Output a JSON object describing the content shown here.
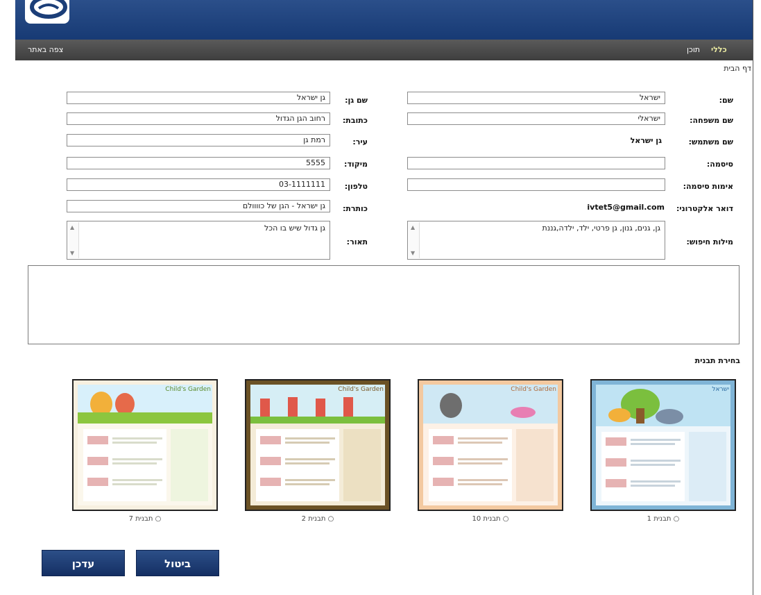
{
  "nav": {
    "left_link": "צפה באתר",
    "tab_general": "כללי",
    "tab_content": "תוכן"
  },
  "breadcrumb": "דף הבית",
  "left_form": [
    {
      "label": "שם גן:",
      "value": "גן ישראל"
    },
    {
      "label": "כתובת:",
      "value": "רחוב הגן הגדול"
    },
    {
      "label": "עיר:",
      "value": "רמת גן"
    },
    {
      "label": "מיקוד:",
      "value": "5555"
    },
    {
      "label": "טלפון:",
      "value": "03-1111111"
    },
    {
      "label": "כותרת:",
      "value": "גן ישראל - הגן של כוווולם"
    }
  ],
  "right_form": {
    "first_name": {
      "label": "שם:",
      "value": "ישראל"
    },
    "last_name": {
      "label": "שם משפחה:",
      "value": "ישראלי"
    },
    "username": {
      "label": "שם משתמש:",
      "value": "גן ישראל"
    },
    "password": {
      "label": "סיסמה:",
      "value": ""
    },
    "password_confirm": {
      "label": "אימות סיסמה:",
      "value": ""
    },
    "email": {
      "label": "דואר אלקטרוני:",
      "value": "ivtet5@gmail.com"
    },
    "keywords": {
      "label": "מילות חיפוש:",
      "value": "גן, גנים, גנון, גן פרטי, ילד, ילדה,גננת"
    }
  },
  "description": {
    "label": "תאור:",
    "value": "גן גדול שיש בו הכל"
  },
  "template_section": "בחירת תבנית",
  "templates": [
    {
      "caption": "תבנית 1",
      "site_title": "ישראל"
    },
    {
      "caption": "תבנית 10",
      "site_title": "Child's Garden"
    },
    {
      "caption": "תבנית 2",
      "site_title": "Child's Garden"
    },
    {
      "caption": "תבנית 7",
      "site_title": "Child's Garden"
    }
  ],
  "buttons": {
    "cancel": "ביטול",
    "update": "עדכן"
  },
  "colors": {
    "header": "#1b3e78",
    "nav": "#4a4a4a",
    "button": "#1f3f7a"
  }
}
